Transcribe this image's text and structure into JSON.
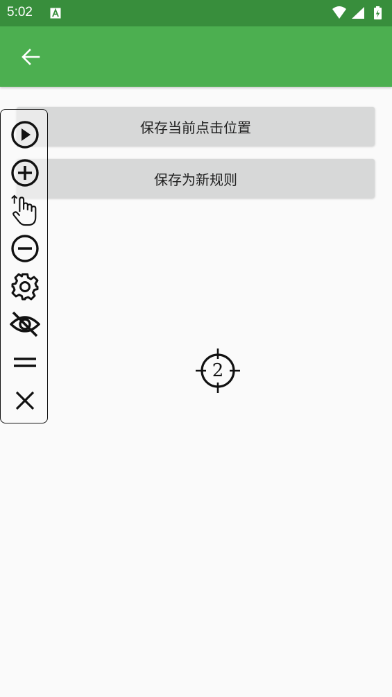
{
  "status_bar": {
    "time": "5:02",
    "icons": [
      "a11y-icon",
      "wifi-icon",
      "cellular-icon",
      "battery-icon"
    ],
    "color": "#388e3c"
  },
  "app_bar": {
    "color": "#4caf50",
    "back_icon": "arrow-back-icon"
  },
  "buttons": {
    "save_click_position": "保存当前点击位置",
    "save_as_rule": "保存为新规则"
  },
  "floating_toolbar": {
    "tools": [
      "play-circle-icon",
      "add-circle-icon",
      "tap-gesture-icon",
      "remove-circle-icon",
      "settings-gear-icon",
      "visibility-off-icon",
      "drag-handle-icon",
      "close-icon"
    ]
  },
  "target": {
    "number": "2"
  }
}
